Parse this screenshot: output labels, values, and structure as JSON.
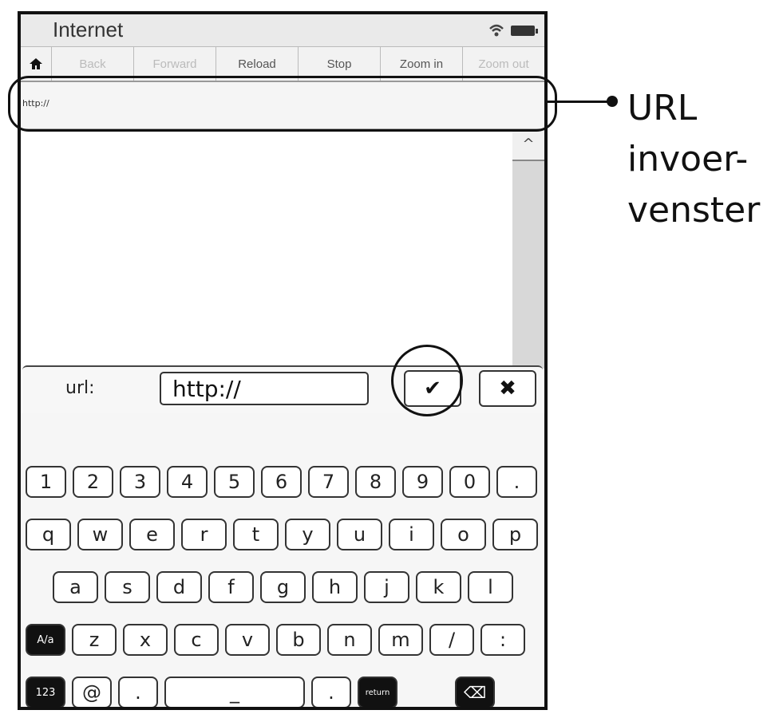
{
  "window": {
    "title": "Internet"
  },
  "toolbar": {
    "buttons": [
      {
        "label": "Back",
        "enabled": false
      },
      {
        "label": "Forward",
        "enabled": false
      },
      {
        "label": "Reload",
        "enabled": true
      },
      {
        "label": "Stop",
        "enabled": true
      },
      {
        "label": "Zoom in",
        "enabled": true
      },
      {
        "label": "Zoom out",
        "enabled": false
      }
    ]
  },
  "address_bar": {
    "value": "http://"
  },
  "scroll": {
    "up_glyph": "^"
  },
  "url_dialog": {
    "label": "url:",
    "value": "http://",
    "ok_glyph": "✔",
    "cancel_glyph": "✖"
  },
  "keyboard": {
    "row1": [
      "1",
      "2",
      "3",
      "4",
      "5",
      "6",
      "7",
      "8",
      "9",
      "0",
      "."
    ],
    "row2": [
      "q",
      "w",
      "e",
      "r",
      "t",
      "y",
      "u",
      "i",
      "o",
      "p"
    ],
    "row3": [
      "a",
      "s",
      "d",
      "f",
      "g",
      "h",
      "j",
      "k",
      "l"
    ],
    "row4": [
      "A/a",
      "z",
      "x",
      "c",
      "v",
      "b",
      "n",
      "m",
      "/",
      ":"
    ],
    "row5": {
      "num": "123",
      "at": "@",
      "dot1": ".",
      "space": "_",
      "dot2": ".",
      "return": "return",
      "backspace": "⌫"
    }
  },
  "annotation": {
    "text": "URL\ninvoer-\nvenster"
  },
  "icons": {
    "home": "home-icon",
    "wifi": "wifi-icon",
    "battery": "battery-icon"
  }
}
